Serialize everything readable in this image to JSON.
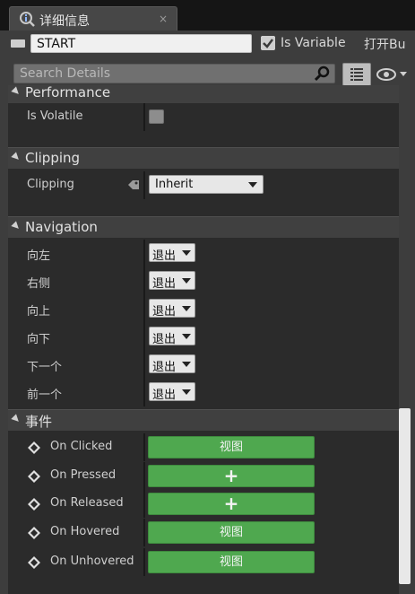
{
  "tab": {
    "title": "详细信息",
    "close": "×"
  },
  "widget": {
    "name": "START",
    "is_variable_label": "Is Variable",
    "open_label": "打开Bu"
  },
  "search": {
    "placeholder": "Search Details"
  },
  "sections": {
    "performance": {
      "title": "Performance",
      "is_volatile_label": "Is Volatile"
    },
    "clipping": {
      "title": "Clipping",
      "clipping_label": "Clipping",
      "clipping_value": "Inherit"
    },
    "navigation": {
      "title": "Navigation",
      "rows": [
        {
          "label": "向左",
          "value": "退出"
        },
        {
          "label": "右侧",
          "value": "退出"
        },
        {
          "label": "向上",
          "value": "退出"
        },
        {
          "label": "向下",
          "value": "退出"
        },
        {
          "label": "下一个",
          "value": "退出"
        },
        {
          "label": "前一个",
          "value": "退出"
        }
      ]
    },
    "events": {
      "title": "事件",
      "rows": [
        {
          "label": "On Clicked",
          "button": "视图"
        },
        {
          "label": "On Pressed",
          "button": "+"
        },
        {
          "label": "On Released",
          "button": "+"
        },
        {
          "label": "On Hovered",
          "button": "视图"
        },
        {
          "label": "On Unhovered",
          "button": "视图"
        }
      ]
    }
  },
  "icons": {
    "tab": "info-icon",
    "search": "search-icon",
    "grid": "grid-view-icon",
    "eye": "eye-visibility-icon",
    "tag": "tag-icon",
    "event": "event-diamond-icon"
  },
  "colors": {
    "accent_green": "#4fa84f",
    "panel": "#3d3d3d",
    "content": "#2b2b2b"
  }
}
